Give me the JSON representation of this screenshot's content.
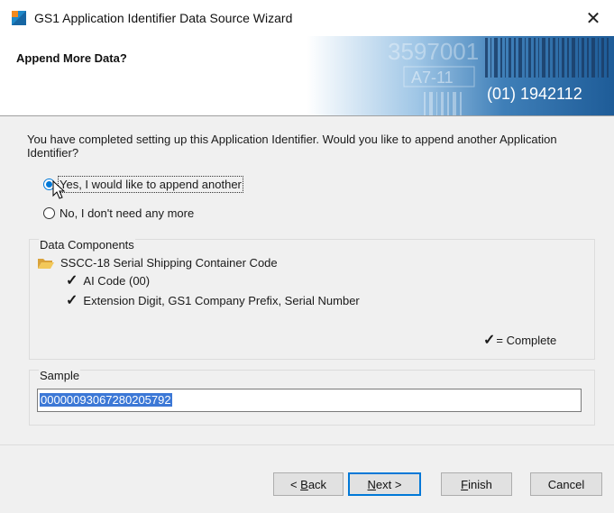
{
  "window": {
    "title": "GS1 Application Identifier Data Source Wizard",
    "close_label": "✕"
  },
  "banner": {
    "heading": "Append More Data?",
    "barcode_text_top": "3597001",
    "barcode_text_mid": "A7-11",
    "barcode_text_bottom": "(01) 1942112"
  },
  "prompt": "You have completed setting up this Application Identifier. Would you like to append another Application Identifier?",
  "options": [
    {
      "label": "Yes, I would like to append another",
      "selected": true
    },
    {
      "label": "No, I don't need any more",
      "selected": false
    }
  ],
  "data_components": {
    "title": "Data Components",
    "root": "SSCC-18 Serial Shipping Container Code",
    "children": [
      "AI Code (00)",
      "Extension Digit, GS1 Company Prefix, Serial Number"
    ],
    "legend": "= Complete",
    "check_glyph": "✓"
  },
  "sample": {
    "title": "Sample",
    "value": "00000093067280205792"
  },
  "buttons": {
    "back": {
      "prefix": "< ",
      "accel": "B",
      "rest": "ack"
    },
    "next": {
      "accel": "N",
      "rest": "ext >"
    },
    "finish": {
      "accel": "F",
      "rest": "inish"
    },
    "cancel": {
      "label": "Cancel"
    }
  },
  "colors": {
    "accent": "#0078d7",
    "selection": "#3c78d6",
    "folder": "#e8b64c"
  }
}
